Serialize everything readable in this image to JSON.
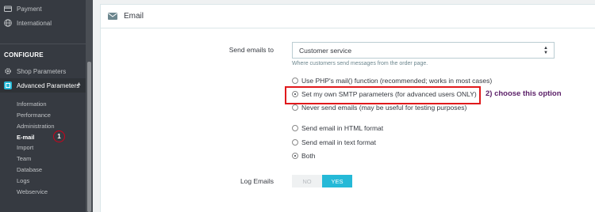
{
  "sidebar": {
    "top_items": [
      {
        "label": "Payment",
        "icon": "credit-card-icon"
      },
      {
        "label": "International",
        "icon": "globe-icon"
      }
    ],
    "section_title": "CONFIGURE",
    "items": [
      {
        "label": "Shop Parameters",
        "icon": "gear-icon"
      },
      {
        "label": "Advanced Parameters",
        "icon": "advanced-params-icon"
      }
    ],
    "sub_items": [
      "Information",
      "Performance",
      "Administration",
      "E-mail",
      "Import",
      "Team",
      "Database",
      "Logs",
      "Webservice"
    ],
    "active_sub_item": "E-mail",
    "annotation_number": "1"
  },
  "panel": {
    "title": "Email",
    "send_emails_to_label": "Send emails to",
    "send_emails_to_value": "Customer service",
    "send_emails_to_help": "Where customers send messages from the order page.",
    "mail_method_options": [
      {
        "label": "Use PHP's mail() function (recommended; works in most cases)",
        "checked": false
      },
      {
        "label": "Set my own SMTP parameters (for advanced users ONLY)",
        "checked": true
      },
      {
        "label": "Never send emails (may be useful for testing purposes)",
        "checked": false
      }
    ],
    "format_options": [
      {
        "label": "Send email in HTML format",
        "checked": false
      },
      {
        "label": "Send email in text format",
        "checked": false
      },
      {
        "label": "Both",
        "checked": true
      }
    ],
    "log_emails_label": "Log Emails",
    "log_emails_no": "NO",
    "log_emails_yes": "YES",
    "log_emails_value": "YES"
  },
  "annotation": {
    "text": "2) choose this option",
    "highlight_color": "#e0191c",
    "text_color": "#5a1e67"
  },
  "colors": {
    "sidebar_bg": "#363a41",
    "accent": "#25b9d7"
  }
}
